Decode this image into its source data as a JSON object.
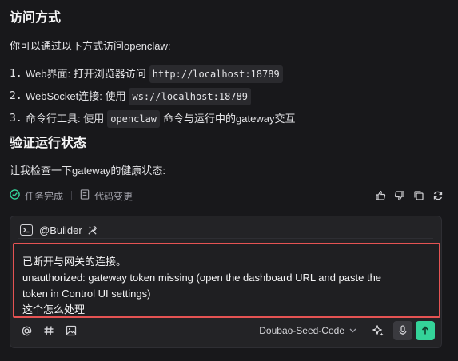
{
  "content": {
    "heading_access": "访问方式",
    "intro": "你可以通过以下方式访问openclaw:",
    "list": [
      {
        "num": "1.",
        "before": "Web界面: 打开浏览器访问",
        "code": "http://localhost:18789",
        "after": ""
      },
      {
        "num": "2.",
        "before": "WebSocket连接: 使用",
        "code": "ws://localhost:18789",
        "after": ""
      },
      {
        "num": "3.",
        "before": "命令行工具: 使用",
        "code": "openclaw",
        "after": "命令与运行中的gateway交互"
      }
    ],
    "heading_verify": "验证运行状态",
    "check_text": "让我检查一下gateway的健康状态:"
  },
  "status": {
    "task_done": "任务完成",
    "code_changes": "代码变更"
  },
  "colors": {
    "accent_green": "#34d399",
    "highlight_red": "#e55353"
  },
  "composer": {
    "agent": "@Builder",
    "input_lines": [
      "已断开与网关的连接。",
      "unauthorized: gateway token missing (open the dashboard URL and paste the",
      "token in Control UI settings)",
      "这个怎么处理"
    ],
    "model": "Doubao-Seed-Code"
  }
}
